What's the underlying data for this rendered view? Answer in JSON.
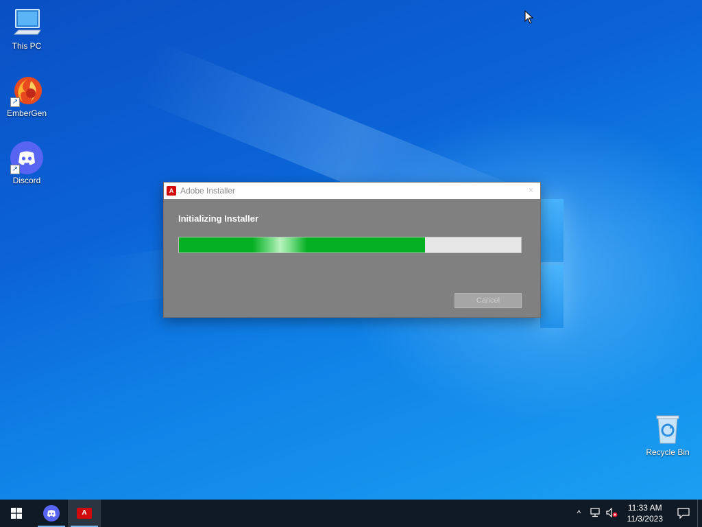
{
  "desktop": {
    "icons": [
      {
        "label": "This PC"
      },
      {
        "label": "EmberGen"
      },
      {
        "label": "Discord"
      },
      {
        "label": "Recycle Bin"
      }
    ]
  },
  "installer": {
    "title": "Adobe Installer",
    "app_icon_text": "A",
    "close_glyph": "×",
    "heading": "Initializing Installer",
    "progress_fraction": 0.72,
    "cancel_label": "Cancel"
  },
  "taskbar": {
    "items": [
      {
        "name": "start-button",
        "icon": "windows-icon"
      },
      {
        "name": "discord",
        "icon": "discord-icon"
      },
      {
        "name": "adobe-installer",
        "icon": "adobe-icon",
        "active": true,
        "icon_text": "A"
      }
    ],
    "tray": {
      "chevron": "^",
      "time": "11:33 AM",
      "date": "11/3/2023"
    }
  },
  "colors": {
    "progress_fill": "#06b025",
    "taskbar_bg": "#101a24",
    "adobe_red": "#d10b0b"
  }
}
